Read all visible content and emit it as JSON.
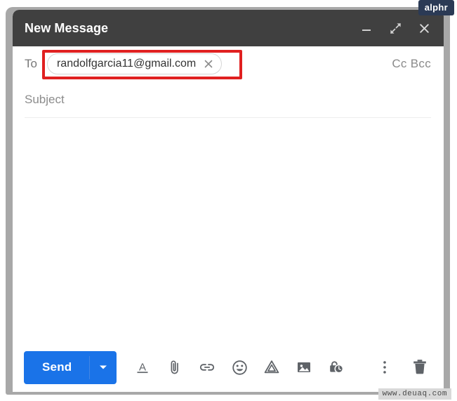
{
  "window": {
    "title": "New Message",
    "controls": [
      {
        "name": "minimize",
        "icon": "minimize-icon",
        "label": "—"
      },
      {
        "name": "expand",
        "icon": "expand-icon",
        "label": "⤢"
      },
      {
        "name": "close",
        "icon": "close-icon",
        "label": "✕"
      }
    ]
  },
  "to_field": {
    "label": "To",
    "recipients": [
      {
        "email": "randolfgarcia11@gmail.com",
        "remove_label": "✕"
      }
    ],
    "cc_bcc_label": "Cc Bcc",
    "highlighted": true,
    "highlight_color": "#e02020"
  },
  "subject_field": {
    "placeholder": "Subject",
    "value": ""
  },
  "message_body": {
    "placeholder": "",
    "value": ""
  },
  "toolbar": {
    "send_label": "Send",
    "send_color": "#1a73e8",
    "send_caret_icon": "chevron-down-icon",
    "icons": [
      {
        "name": "formatting-options-icon",
        "title": "Formatting options"
      },
      {
        "name": "attach-file-icon",
        "title": "Attach files"
      },
      {
        "name": "insert-link-icon",
        "title": "Insert link"
      },
      {
        "name": "insert-emoji-icon",
        "title": "Insert emoji"
      },
      {
        "name": "insert-drive-icon",
        "title": "Insert files using Drive"
      },
      {
        "name": "insert-photo-icon",
        "title": "Insert photo"
      },
      {
        "name": "confidential-mode-icon",
        "title": "Toggle confidential mode"
      }
    ],
    "right_icons": [
      {
        "name": "more-options-icon",
        "title": "More options"
      },
      {
        "name": "discard-draft-icon",
        "title": "Discard draft"
      }
    ]
  },
  "watermarks": {
    "brand_badge": "alphr",
    "site_url": "www.deuaq.com"
  }
}
